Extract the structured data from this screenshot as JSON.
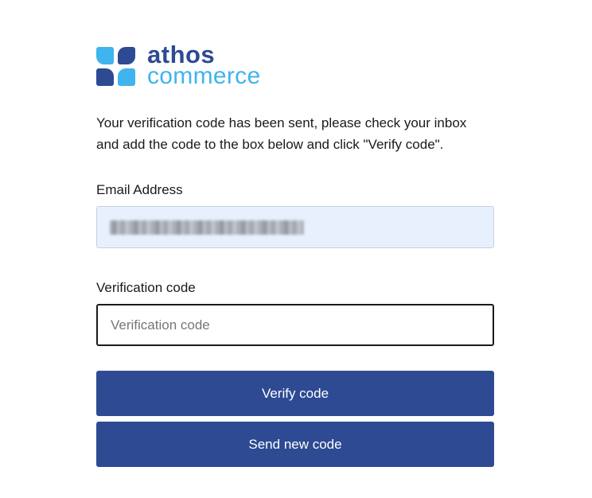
{
  "brand": {
    "name_line1": "athos",
    "name_line2": "commerce",
    "color_dark": "#2d4a93",
    "color_light": "#40b4ee"
  },
  "intro_text": "Your verification code has been sent, please check your inbox and add the code to the box below and click \"Verify code\".",
  "email": {
    "label": "Email Address",
    "value_obscured": true
  },
  "verification": {
    "label": "Verification code",
    "placeholder": "Verification code"
  },
  "buttons": {
    "verify_label": "Verify code",
    "resend_label": "Send new code"
  },
  "colors": {
    "button_bg": "#2d4a93",
    "email_field_bg": "#e8f0fe"
  }
}
